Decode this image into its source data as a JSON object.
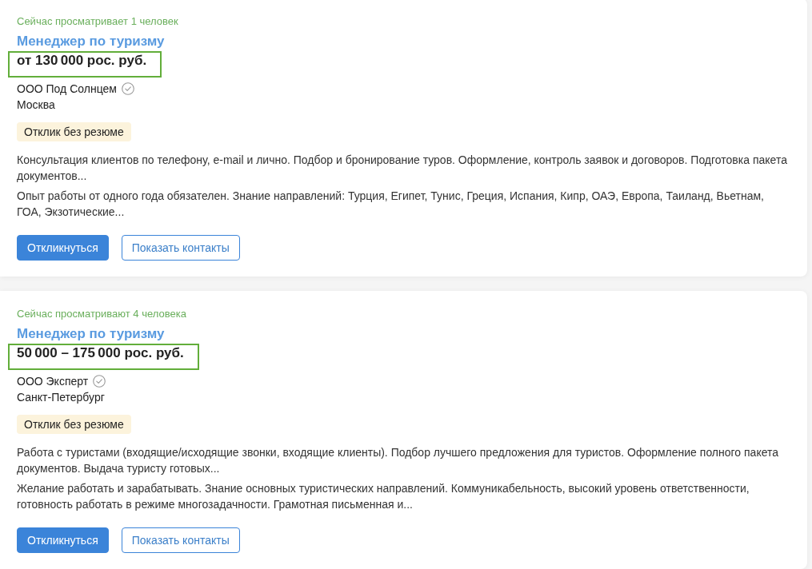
{
  "vacancies": [
    {
      "viewers": "Сейчас просматривает 1 человек",
      "title": "Менеджер по туризму",
      "salary": "от 130 000 рос. руб.",
      "salary_highlighted": true,
      "company": "ООО Под Солнцем",
      "company_verified": true,
      "city": "Москва",
      "badges": [
        "Отклик без резюме"
      ],
      "snippets": [
        "Консультация клиентов по телефону, e-mail и лично. Подбор и бронирование туров. Оформление, контроль заявок и договоров. Подготовка пакета документов...",
        "Опыт работы от одного года обязателен. Знание направлений: Турция, Египет, Тунис, Греция, Испания, Кипр, ОАЭ, Европа, Таиланд, Вьетнам, ГОА, Экзотические..."
      ],
      "buttons": [
        {
          "label": "Откликнуться",
          "kind": "primary"
        },
        {
          "label": "Показать контакты",
          "kind": "outline"
        }
      ]
    },
    {
      "viewers": "Сейчас просматривают 4 человека",
      "title": "Менеджер по туризму",
      "salary": "50 000 – 175 000 рос. руб.",
      "salary_highlighted": true,
      "company": "ООО Эксперт",
      "company_verified": true,
      "city": "Санкт-Петербург",
      "badges": [
        "Отклик без резюме"
      ],
      "snippets": [
        "Работа с туристами (входящие/исходящие звонки, входящие клиенты). Подбор лучшего предложения для туристов. Оформление полного пакета документов. Выдача туристу готовых...",
        "Желание работать и зарабатывать. Знание основных туристических направлений. Коммуникабельность, высокий уровень ответственности, готовность работать в режиме многозадачности. Грамотная письменная и..."
      ],
      "buttons": [
        {
          "label": "Откликнуться",
          "kind": "primary"
        },
        {
          "label": "Показать контакты",
          "kind": "outline"
        }
      ]
    }
  ]
}
